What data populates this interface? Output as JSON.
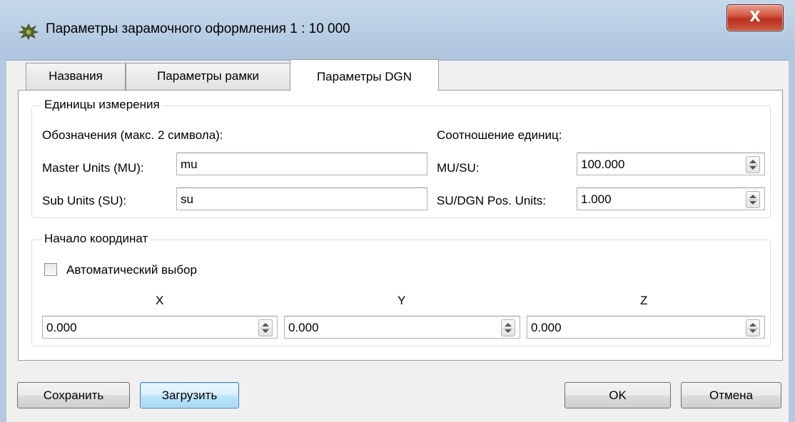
{
  "window": {
    "title": "Параметры зарамочного оформления 1 : 10 000",
    "close_label": "X"
  },
  "tabs": [
    {
      "label": "Названия"
    },
    {
      "label": "Параметры рамки"
    },
    {
      "label": "Параметры DGN"
    }
  ],
  "units": {
    "group_title": "Единицы измерения",
    "designations_label": "Обозначения (макс. 2 символа):",
    "ratio_label": "Соотношение единиц:",
    "master_label": "Master Units (MU):",
    "master_value": "mu",
    "sub_label": "Sub Units (SU):",
    "sub_value": "su",
    "mu_su_label": "MU/SU:",
    "mu_su_value": "100.000",
    "su_dgn_label": "SU/DGN Pos. Units:",
    "su_dgn_value": "1.000"
  },
  "origin": {
    "group_title": "Начало координат",
    "auto_label": "Автоматический выбор",
    "auto_checked": false,
    "x_label": "X",
    "y_label": "Y",
    "z_label": "Z",
    "x_value": "0.000",
    "y_value": "0.000",
    "z_value": "0.000"
  },
  "buttons": {
    "save": "Сохранить",
    "load": "Загрузить",
    "ok": "OK",
    "cancel": "Отмена"
  },
  "colors": {
    "titlebar": "#b7cce2",
    "close_button": "#c7432c",
    "focus_button": "#bee6fd"
  }
}
